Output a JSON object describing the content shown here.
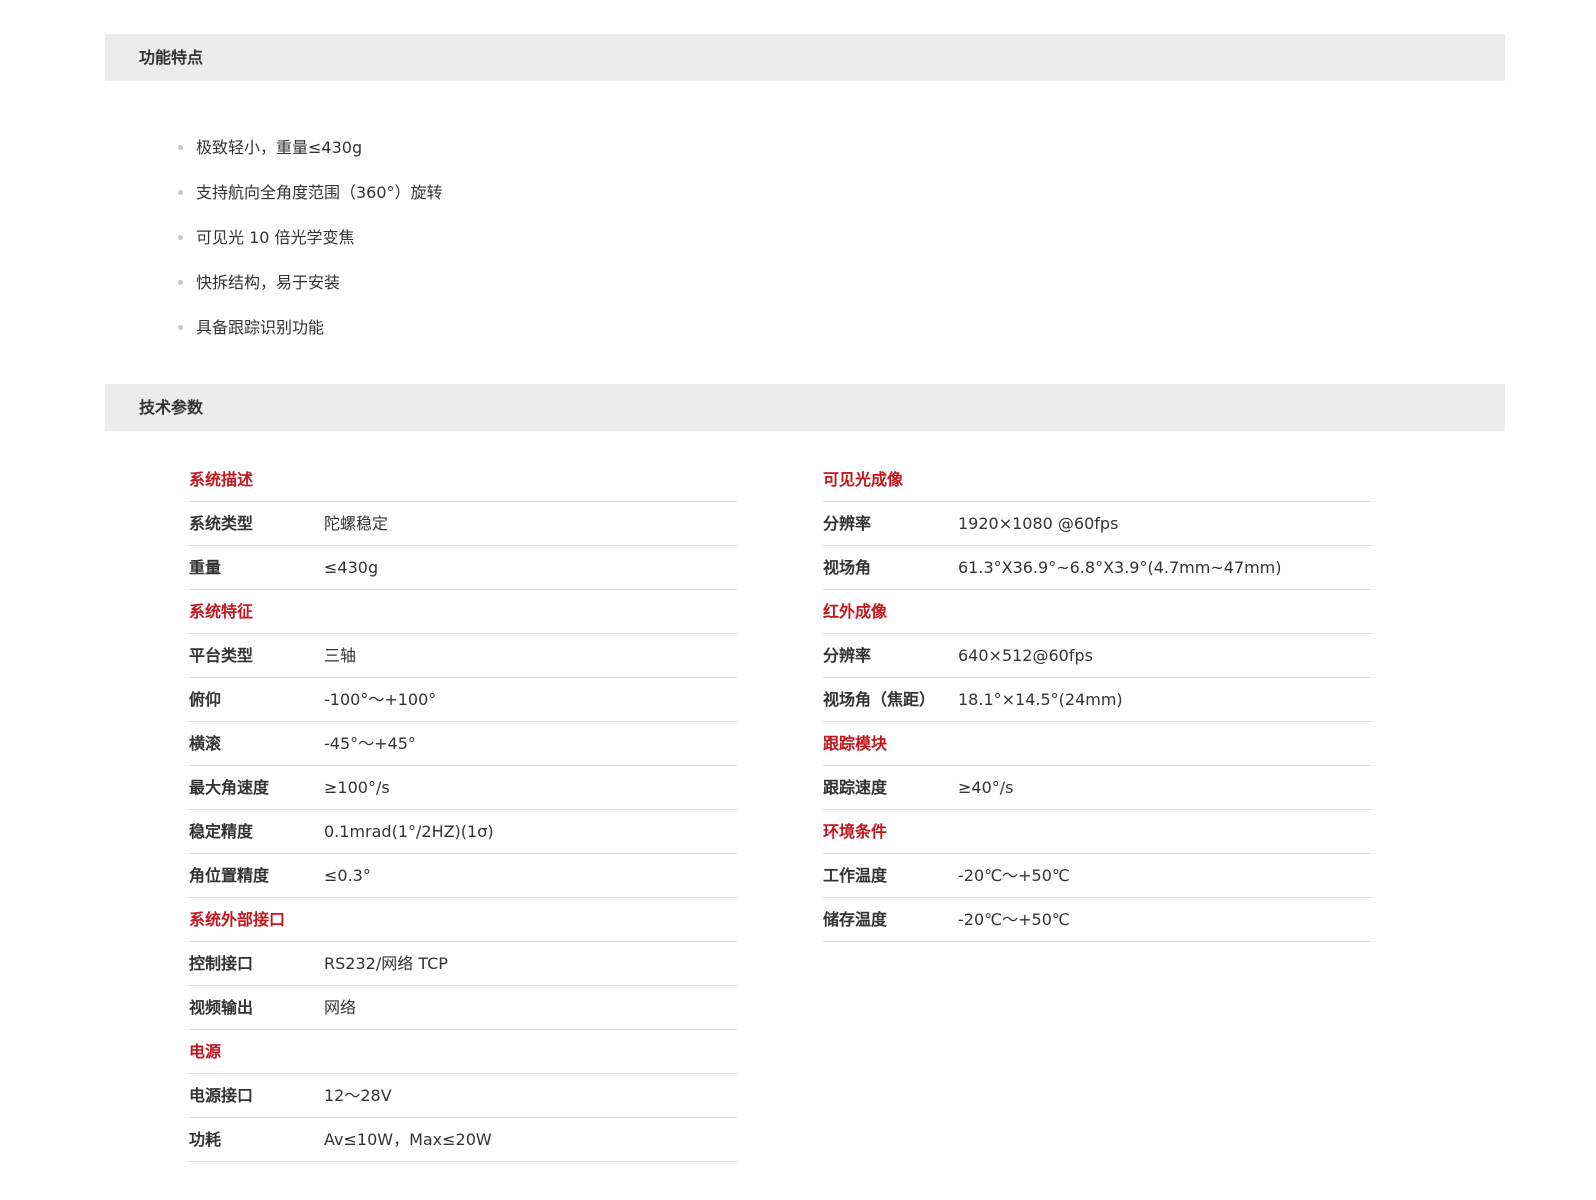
{
  "features": {
    "title": "功能特点",
    "items": [
      "极致轻小，重量≤430g",
      "支持航向全角度范围（360°）旋转",
      "可见光 10 倍光学变焦",
      "快拆结构，易于安装",
      "具备跟踪识别功能"
    ]
  },
  "specs": {
    "title": "技术参数",
    "left": [
      {
        "group": "系统描述",
        "rows": [
          {
            "label": "系统类型",
            "value": "陀螺稳定"
          },
          {
            "label": "重量",
            "value": "≤430g"
          }
        ]
      },
      {
        "group": "系统特征",
        "rows": [
          {
            "label": "平台类型",
            "value": "三轴"
          },
          {
            "label": "俯仰",
            "value": "-100°～+100°"
          },
          {
            "label": "横滚",
            "value": "-45°～+45°"
          },
          {
            "label": "最大角速度",
            "value": "≥100°/s"
          },
          {
            "label": "稳定精度",
            "value": "0.1mrad(1°/2HZ)(1σ)"
          },
          {
            "label": "角位置精度",
            "value": "≤0.3°"
          }
        ]
      },
      {
        "group": "系统外部接口",
        "rows": [
          {
            "label": "控制接口",
            "value": "RS232/网络 TCP"
          },
          {
            "label": "视频输出",
            "value": "网络"
          }
        ]
      },
      {
        "group": "电源",
        "rows": [
          {
            "label": "电源接口",
            "value": "12～28V"
          },
          {
            "label": "功耗",
            "value": "Av≤10W，Max≤20W"
          }
        ]
      }
    ],
    "right": [
      {
        "group": "可见光成像",
        "rows": [
          {
            "label": "分辨率",
            "value": "1920×1080 @60fps"
          },
          {
            "label": "视场角",
            "value": "61.3°X36.9°~6.8°X3.9°(4.7mm~47mm)"
          }
        ]
      },
      {
        "group": "红外成像",
        "rows": [
          {
            "label": "分辨率",
            "value": "640×512@60fps"
          },
          {
            "label": "视场角（焦距）",
            "value": "18.1°×14.5°(24mm)"
          }
        ]
      },
      {
        "group": "跟踪模块",
        "rows": [
          {
            "label": "跟踪速度",
            "value": "≥40°/s"
          }
        ]
      },
      {
        "group": "环境条件",
        "rows": [
          {
            "label": "工作温度",
            "value": "-20℃～+50℃"
          },
          {
            "label": "储存温度",
            "value": "-20℃～+50℃"
          }
        ]
      }
    ]
  },
  "colors": {
    "accent": "#c4161c",
    "bar_background": "#ececec",
    "text": "#333333",
    "divider": "#dddddd"
  }
}
